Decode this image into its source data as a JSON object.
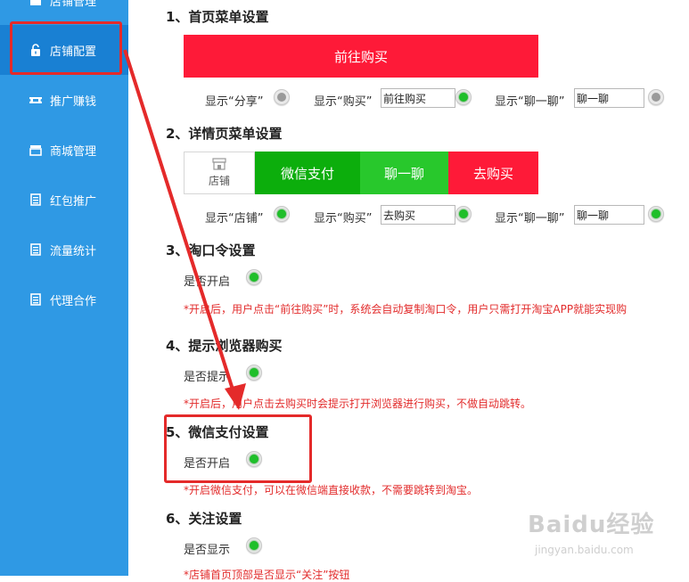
{
  "sidebar": {
    "items": [
      {
        "label": "店铺管理",
        "icon": "store-icon"
      },
      {
        "label": "店铺配置",
        "icon": "lock-icon",
        "active": true
      },
      {
        "label": "推广赚钱",
        "icon": "ticket-icon"
      },
      {
        "label": "商城管理",
        "icon": "shop-icon"
      },
      {
        "label": "红包推广",
        "icon": "document-icon"
      },
      {
        "label": "流量统计",
        "icon": "document-icon"
      },
      {
        "label": "代理合作",
        "icon": "document-icon"
      }
    ]
  },
  "sections": {
    "home_menu": {
      "title": "1、首页菜单设置",
      "buy_button": "前往购买",
      "share_label": "显示“分享”",
      "share_on": false,
      "buy_label": "显示“购买”",
      "buy_value": "前往购买",
      "buy_on": true,
      "chat_label": "显示“聊一聊”",
      "chat_value": "聊一聊",
      "chat_on": false
    },
    "detail_menu": {
      "title": "2、详情页菜单设置",
      "store_button": "店铺",
      "wechat_pay_button": "微信支付",
      "chat_button": "聊一聊",
      "buy_button": "去购买",
      "store_label": "显示“店铺”",
      "store_on": true,
      "buy_label": "显示“购买”",
      "buy_value": "去购买",
      "buy_on": true,
      "chat_label": "显示“聊一聊”",
      "chat_value": "聊一聊",
      "chat_on": true
    },
    "taobao_code": {
      "title": "3、淘口令设置",
      "enable_label": "是否开启",
      "enabled": true,
      "note": "*开启后，用户点击“前往购买”时，系统会自动复制淘口令，用户只需打开淘宝APP就能实现购"
    },
    "browser_buy": {
      "title": "4、提示浏览器购买",
      "enable_label": "是否提示",
      "enabled": true,
      "note": "*开启后，用户点击去购买时会提示打开浏览器进行购买，不做自动跳转。"
    },
    "wechat_pay": {
      "title": "5、微信支付设置",
      "enable_label": "是否开启",
      "enabled": true,
      "note": "*开启微信支付，可以在微信端直接收款，不需要跳转到淘宝。"
    },
    "follow": {
      "title": "6、关注设置",
      "enable_label": "是否显示",
      "enabled": true,
      "note": "*店铺首页顶部是否显示“关注”按钮"
    }
  },
  "watermark": {
    "logo": "Baidu经验",
    "url": "jingyan.baidu.com"
  },
  "colors": {
    "sidebar": "#2f99e4",
    "sidebar_active": "#1980d3",
    "buy_red": "#fe1a38",
    "wechat_green": "#0cae0c",
    "chat_green": "#28c82c",
    "toggle_on": "#1fbf2a",
    "note_red": "#e22b2b",
    "annotation_red": "#e42a2a"
  }
}
